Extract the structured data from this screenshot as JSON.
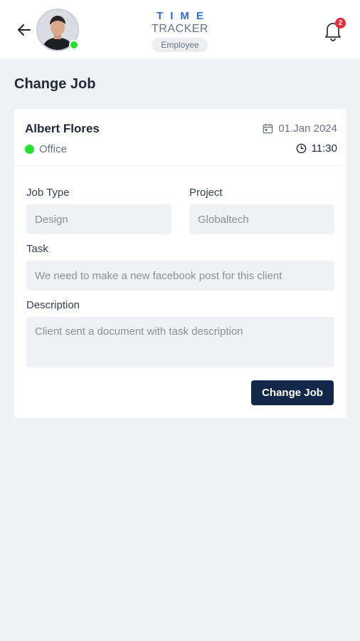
{
  "header": {
    "brand_line1": "TIME",
    "brand_line2": "TRACKER",
    "role": "Employee",
    "notification_count": "2"
  },
  "page": {
    "title": "Change Job"
  },
  "employee": {
    "name": "Albert Flores",
    "status": "Office",
    "date": "01.Jan 2024",
    "time": "11:30"
  },
  "form": {
    "job_type_label": "Job Type",
    "job_type_value": "Design",
    "project_label": "Project",
    "project_value": "Globaltech",
    "task_label": "Task",
    "task_value": "We need to make a new facebook post for this client",
    "description_label": "Description",
    "description_value": "Client sent a document with task description",
    "submit_label": "Change Job"
  },
  "colors": {
    "brand_blue": "#2f6bd8",
    "online_green": "#22e22b",
    "badge_red": "#ea2b3b",
    "button_navy": "#12284a"
  }
}
